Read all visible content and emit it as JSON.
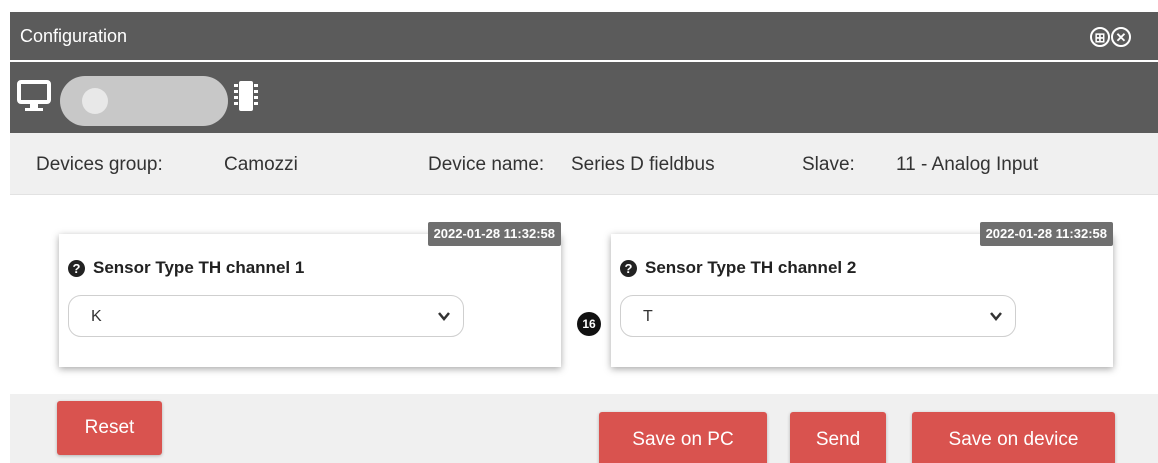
{
  "window": {
    "title": "Configuration"
  },
  "toolbar": {
    "mode_toggle_state": "pc"
  },
  "info": {
    "group_label": "Devices group:",
    "group_value": "Camozzi",
    "name_label": "Device name:",
    "name_value": "Series D fieldbus",
    "slave_label": "Slave:",
    "slave_value": "11 - Analog Input"
  },
  "cards": [
    {
      "timestamp": "2022-01-28 11:32:58",
      "label": "Sensor Type TH channel 1",
      "value": "K"
    },
    {
      "timestamp": "2022-01-28 11:32:58",
      "label": "Sensor Type TH channel 2",
      "value": "T"
    }
  ],
  "marker": "16",
  "footer": {
    "reset": "Reset",
    "save_pc": "Save on PC",
    "send": "Send",
    "save_device": "Save on device"
  },
  "colors": {
    "titlebar": "#5b5b5b",
    "button": "#d9534f",
    "panel": "#f0f0f0"
  },
  "icons": {
    "minimize": "collapse-circle-icon",
    "close": "close-circle-icon",
    "help": "question-circle-icon"
  }
}
